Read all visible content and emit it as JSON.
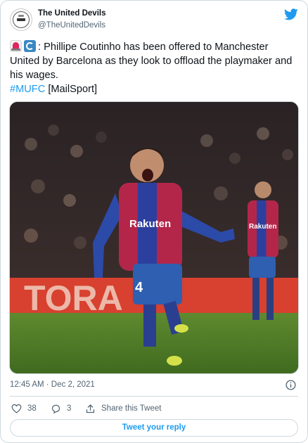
{
  "account": {
    "display_name": "The United Devils",
    "handle": "@TheUnitedDevils",
    "avatar_icon": "club-crest-avatar"
  },
  "tweet": {
    "emoji_1": "rotating-light-emoji",
    "emoji_2": "counterclockwise-arrows-emoji",
    "body": ": Phillipe Coutinho has been offered to Manchester United by Barcelona as they look to offload the playmaker and his wages.",
    "hashtag": "#MUFC",
    "source": "[MailSport]",
    "timestamp": "12:45 AM · Dec 2, 2021",
    "photo": {
      "shirt_sponsor": "Rakuten",
      "shirt_number": "4",
      "board_text": "TORA"
    }
  },
  "actions": {
    "like_count": "38",
    "reply_count": "3",
    "share_label": "Share this Tweet",
    "reply_button": "Tweet your reply"
  },
  "colors": {
    "accent": "#1d9bf0",
    "text": "#0f1419",
    "muted": "#536471",
    "border": "#cfd9de"
  }
}
